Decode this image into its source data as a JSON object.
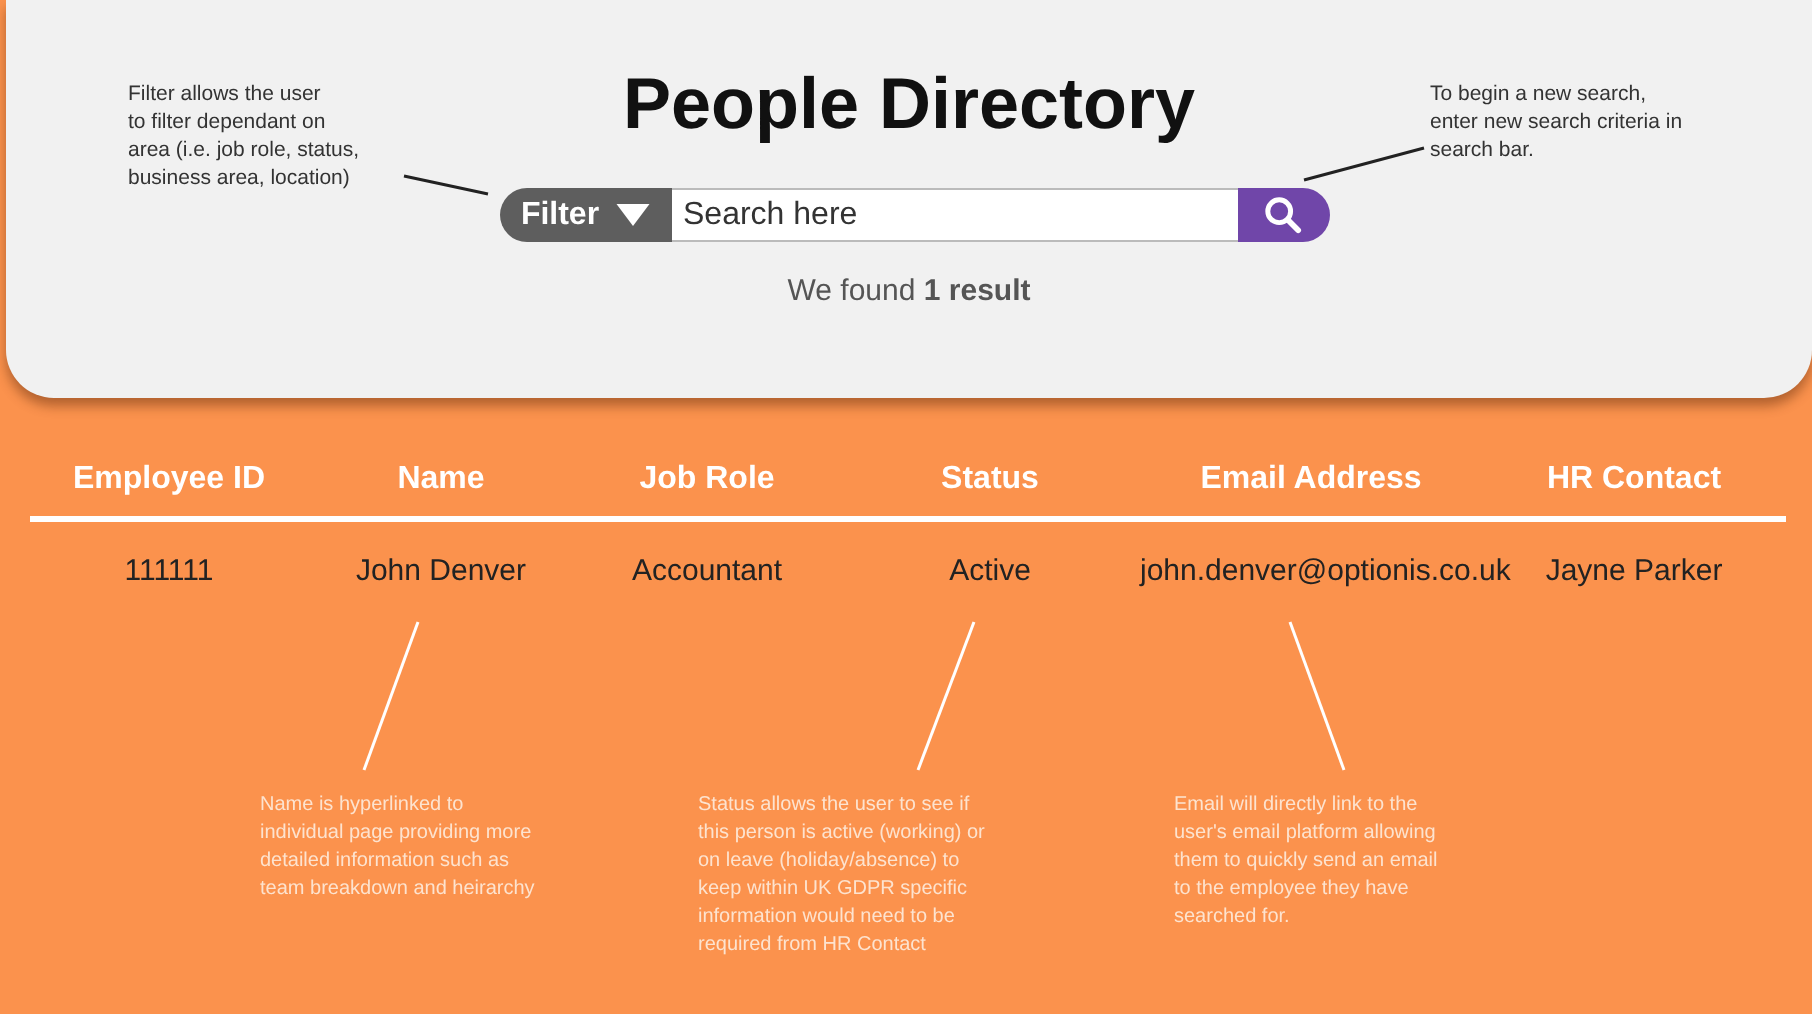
{
  "header": {
    "title": "People Directory",
    "filter_button": {
      "label": "Filter"
    },
    "search": {
      "placeholder": "Search here"
    },
    "result_summary": "We found **1 result**"
  },
  "table": {
    "columns": [
      "Employee ID",
      "Name",
      "Job Role",
      "Status",
      "Email Address",
      "HR Contact"
    ],
    "rows": [
      {
        "cells": [
          "111111",
          "John Denver",
          "Accountant",
          "Active",
          "john.denver@optionis.co.uk",
          "Jayne Parker"
        ]
      }
    ]
  },
  "annotations": [
    {
      "kind": "header",
      "text": "Filter allows the user\nto filter dependant on\narea (i.e. job role, status,\nbusiness area, location)"
    },
    {
      "kind": "header",
      "text": "To begin a new search,\nenter new search criteria in\nsearch bar."
    },
    {
      "kind": "table",
      "text": "Name is hyperlinked to\nindividual page providing more\ndetailed information such as\nteam breakdown and heirarchy"
    },
    {
      "kind": "table",
      "text": "Status allows the user to see if\nthis person is active (working) or\non leave (holiday/absence) to\nkeep within UK GDPR specific\ninformation would need to be\nrequired from HR Contact"
    },
    {
      "kind": "table",
      "text": "Email will directly link to the\nuser's email platform allowing\nthem to quickly send an email\nto the employee they have\nsearched for."
    }
  ]
}
